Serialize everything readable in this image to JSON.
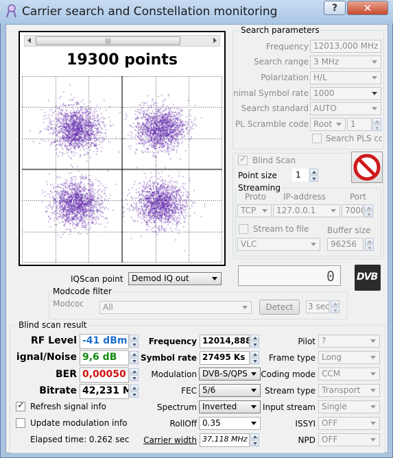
{
  "window": {
    "title": "Carrier search and Constellation monitoring",
    "help_label": "?",
    "close_label": "✕"
  },
  "plot": {
    "points_label": "19300 points",
    "scroll_grip": "|||"
  },
  "search": {
    "title": "Search parameters",
    "frequency_label": "Frequency",
    "frequency_value": "12013,000 MHz",
    "range_label": "Search range",
    "range_value": "3 MHz",
    "polarization_label": "Polarization",
    "polarization_value": "H/L",
    "symrate_label": "nimal Symbol rate",
    "symrate_value": "1000",
    "standard_label": "Search standard",
    "standard_value": "AUTO",
    "pls_label": "PL Scramble code",
    "pls_mode": "Root",
    "pls_value": "1",
    "search_pls_label": "Search PLS cc"
  },
  "blind": {
    "label": "Blind Scan",
    "checked": true,
    "point_size_label": "Point size",
    "point_size_value": "1"
  },
  "streaming": {
    "title": "Streaming",
    "proto_label": "Proto",
    "ip_label": "IP-address",
    "port_label": "Port",
    "proto_value": "TCP",
    "ip_value": "127.0.0.1",
    "port_value": "7000",
    "to_file_label": "Stream to file",
    "buffer_label": "Buffer size",
    "player_value": "VLC",
    "buffer_value": "96256"
  },
  "iq": {
    "label": "IQScan point",
    "value": "Demod IQ out",
    "counter": "0",
    "logo": "DVB"
  },
  "modcode": {
    "title": "Modcode filter",
    "label": "Modcode",
    "value": "All",
    "detect_label": "Detect",
    "interval_value": "3 sec"
  },
  "result": {
    "title": "Blind scan result",
    "rf_label": "RF Level",
    "rf_value": "-41 dBm",
    "sn_label": "ignal/Noise",
    "sn_value": "9,6 dB",
    "ber_label": "BER",
    "ber_value": "0,00050",
    "bitrate_label": "Bitrate",
    "bitrate_value": "42,231 M",
    "freq_label": "Frequency",
    "freq_value": "12014,888",
    "sr_label": "Symbol rate",
    "sr_value": "27495 Ks",
    "modulation_label": "Modulation",
    "modulation_value": "DVB-S/QPS",
    "fec_label": "FEC",
    "fec_value": "5/6",
    "spectrum_label": "Spectrum",
    "spectrum_value": "Inverted",
    "rolloff_label": "RollOff",
    "rolloff_value": "0.35",
    "cw_label": "Carrier width",
    "cw_value": "37,118 MHz",
    "pilot_label": "Pilot",
    "pilot_value": "?",
    "frametype_label": "Frame type",
    "frametype_value": "Long",
    "coding_label": "Coding mode",
    "coding_value": "CCM",
    "streamtype_label": "Stream type",
    "streamtype_value": "Transport",
    "input_label": "Input stream",
    "input_value": "Single",
    "issyi_label": "ISSYI",
    "issyi_value": "OFF",
    "npd_label": "NPD",
    "npd_value": "OFF",
    "refresh_label": "Refresh signal info",
    "refresh_checked": true,
    "update_label": "Update modulation info",
    "update_checked": false,
    "elapsed_label": "Elapsed time: 0.262 sec"
  },
  "colors": {
    "rf": "#1e6fd0",
    "sn": "#118a11",
    "ber": "#d01010",
    "points": "#5b1fa8"
  }
}
